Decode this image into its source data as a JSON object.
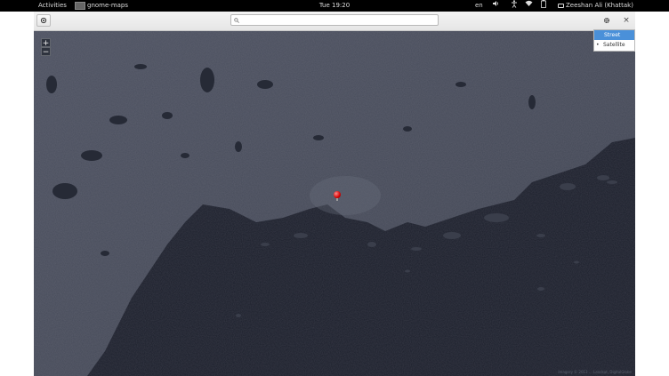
{
  "topbar": {
    "activities": "Activities",
    "app_name": "gnome-maps",
    "clock": "Tue 19:20",
    "language": "en",
    "user": "Zeeshan Ali (Khattak)",
    "tray_icons": [
      "volume-icon",
      "accessibility-icon",
      "wifi-icon",
      "battery-icon"
    ]
  },
  "headerbar": {
    "locate_icon": "locate-icon",
    "search": {
      "value": "",
      "placeholder": ""
    },
    "layers_icon": "gear-icon",
    "close": "×"
  },
  "layer_menu": {
    "options": [
      {
        "label": "Street",
        "selected": true
      },
      {
        "label": "Satellite",
        "selected": false
      }
    ]
  },
  "map": {
    "zoom_in": "+",
    "zoom_out": "−",
    "marker": "location-pin-icon",
    "attribution": "Imagery © 2013 ... Landsat, DigitalGlobe"
  },
  "colors": {
    "topbar_bg": "#000000",
    "water": "#1b1f2b",
    "land": "#4a4f5e",
    "selection": "#4a90d9",
    "marker": "#d40000"
  }
}
